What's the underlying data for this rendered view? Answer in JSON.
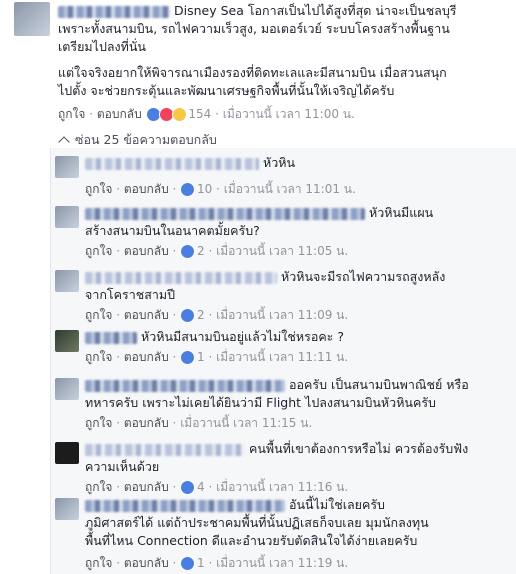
{
  "top_comment": {
    "line1_text": "Disney Sea โอกาสเป็นไปได้สูงที่สุด น่าจะเป็นชลบุรี",
    "line2_text": "เพราะทั้งสนามบิน, รถไฟความเร็วสูง, มอเตอร์เวย์ ระบบโครงสร้างพื้นฐาน",
    "line3_text": "เตรียมไปลงที่นั่น",
    "para2_line1": "แต่ใจจริงอยากให้พิจารณาเมืองรองที่ติดทะเลและมีสนามบิน เมื่อสวนสนุก",
    "para2_line2": "ไปตั้ง จะช่วยกระตุ้นและพัฒนาเศรษฐกิจพื้นที่นั้นให้เจริญได้ครับ",
    "like_label": "ถูกใจ",
    "reply_label": "ตอบกลับ",
    "reaction_count": "154",
    "time": "เมื่อวานนี้ เวลา 11:00 น."
  },
  "hide_replies_label": "ซ่อน 25 ข้อความตอบกลับ",
  "replies": [
    {
      "line1": "หัวหิน",
      "line2": "",
      "count": "10",
      "time": "เมื่อวานนี้ เวลา 11:01 น."
    },
    {
      "line1": "หัวหินมีแผน",
      "line2": "สร้างสนามบินในอนาคตมั้ยครับ?",
      "count": "2",
      "time": "เมื่อวานนี้ เวลา 11:05 น."
    },
    {
      "line1": "หัวหินจะมีรถไฟความรถสูงหลัง",
      "line2": "จากโคราชสามปี",
      "count": "2",
      "time": "เมื่อวานนี้ เวลา 11:09 น."
    },
    {
      "line1": "หัวหินมีสนามบินอยู่แล้วไม่ใช่หรอคะ ?",
      "line2": "",
      "count": "1",
      "time": "เมื่อวานนี้ เวลา 11:11 น."
    },
    {
      "line1": "ออครับ เป็นสนามบินพาณิชย์ หรือ",
      "line2": "ทหารครับ เพราะไม่เคยได้ยินว่ามี Flight ไปลงสนามบินหัวหินครับ",
      "count": "",
      "time": "เมื่อวานนี้ เวลา 11:15 น."
    },
    {
      "line1": "คนพื้นที่เขาต้องการหรือไม่ ควรต้องรับฟัง",
      "line2": "ความเห็นด้วย",
      "count": "4",
      "time": "เมื่อวานนี้ เวลา 11:16 น."
    },
    {
      "line1": "อันนี้ไม่ใช่เลยครับ",
      "line2": "ภูมิศาสตร์ได้ แต่ถ้าประชาคมพื้นที่นั้นปฏิเสธก็จบเลย มุมนักลงทุน",
      "line3": "พื้นที่ไหน Connection ดีและอำนวยรับตัดสินใจได้ง่ายเลยครับ",
      "count": "1",
      "time": "เมื่อวานนี้ เวลา 11:19 น."
    }
  ],
  "colors": {
    "link": "#365899",
    "meta": "#90949c",
    "like": "#4a7fe0"
  }
}
